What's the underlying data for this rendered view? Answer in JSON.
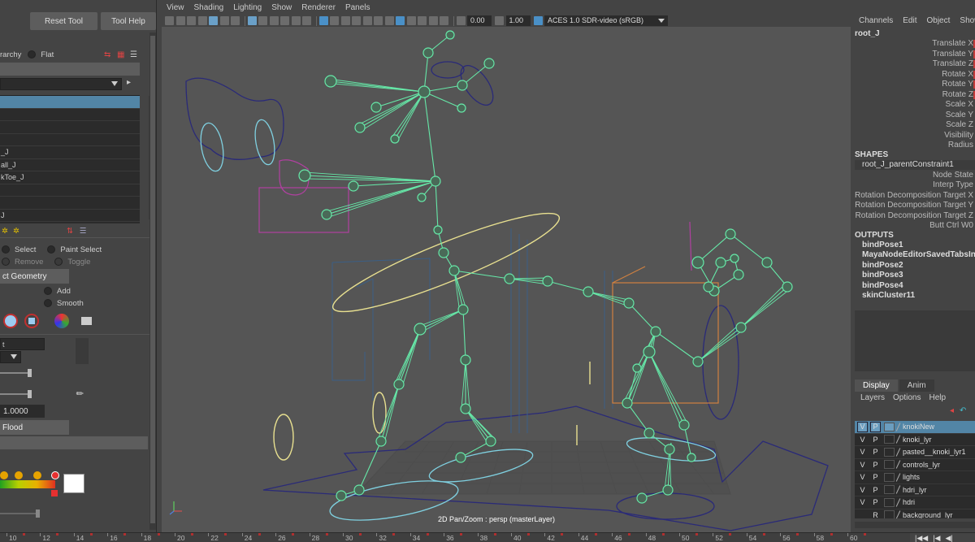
{
  "left_panel": {
    "reset_tool": "Reset Tool",
    "tool_help": "Tool Help",
    "hierarchy_label": "rarchy",
    "flat_label": "Flat",
    "joints": [
      "",
      "",
      "",
      "",
      "_J",
      "all_J",
      "kToe_J",
      "",
      "",
      "J"
    ],
    "select_label": "Select",
    "paint_select_label": "Paint Select",
    "remove_label": "Remove",
    "toggle_label": "Toggle",
    "geometry_button": "ct Geometry",
    "add_label": "Add",
    "smooth_label": "Smooth",
    "dropdown_text": "t",
    "value_field": "1.0000",
    "flood_button": "Flood"
  },
  "viewport": {
    "menu": [
      "View",
      "Shading",
      "Lighting",
      "Show",
      "Renderer",
      "Panels"
    ],
    "exposure": "0.00",
    "gamma": "1.00",
    "color_space": "ACES 1.0 SDR-video (sRGB)",
    "status": "2D Pan/Zoom : persp (masterLayer)"
  },
  "channel_box": {
    "menu": [
      "Channels",
      "Edit",
      "Object",
      "Show"
    ],
    "node": "root_J",
    "attributes": [
      "Translate X",
      "Translate Y",
      "Translate Z",
      "Rotate X",
      "Rotate Y",
      "Rotate Z",
      "Scale X",
      "Scale Y",
      "Scale Z",
      "Visibility",
      "Radius"
    ],
    "shapes_heading": "SHAPES",
    "shape_node": "root_J_parentConstraint1",
    "shape_attrs": [
      "Node State",
      "Interp Type",
      "Rotation Decomposition Target X",
      "Rotation Decomposition Target Y",
      "Rotation Decomposition Target Z",
      "Butt Ctrl W0"
    ],
    "outputs_heading": "OUTPUTS",
    "outputs": [
      "bindPose1",
      "MayaNodeEditorSavedTabsInfo",
      "bindPose2",
      "bindPose3",
      "bindPose4",
      "skinCluster11"
    ]
  },
  "layer_editor": {
    "tabs": [
      "Display",
      "Anim"
    ],
    "active_tab": "Display",
    "menu": [
      "Layers",
      "Options",
      "Help"
    ],
    "layers": [
      {
        "v": "V",
        "p": "P",
        "name": "knokiNew",
        "selected": true
      },
      {
        "v": "V",
        "p": "P",
        "name": "knoki_lyr",
        "selected": false
      },
      {
        "v": "V",
        "p": "P",
        "name": "pasted__knoki_lyr1",
        "selected": false
      },
      {
        "v": "V",
        "p": "P",
        "name": "controls_lyr",
        "selected": false
      },
      {
        "v": "V",
        "p": "P",
        "name": "lights",
        "selected": false
      },
      {
        "v": "V",
        "p": "P",
        "name": "hdri_lyr",
        "selected": false
      },
      {
        "v": "V",
        "p": "P",
        "name": "hdri",
        "selected": false
      },
      {
        "v": "",
        "p": "R",
        "name": "background_lyr",
        "selected": false
      }
    ]
  },
  "timeline": {
    "ticks": [
      "10",
      "12",
      "14",
      "16",
      "18",
      "20",
      "22",
      "24",
      "26",
      "28",
      "30",
      "32",
      "34",
      "36",
      "38",
      "40",
      "42",
      "44",
      "46",
      "48",
      "50",
      "52",
      "54",
      "56",
      "58",
      "60"
    ]
  },
  "playback": {
    "buttons": [
      "|◀◀",
      "|◀",
      "◀|"
    ]
  }
}
